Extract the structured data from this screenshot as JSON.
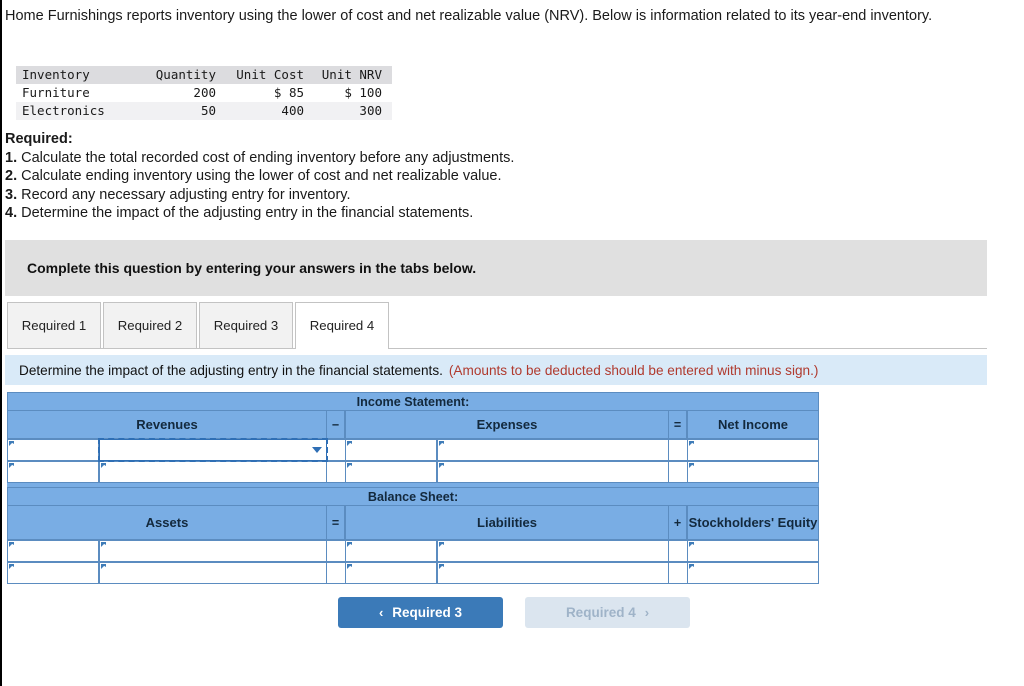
{
  "intro": {
    "text": "Home Furnishings reports inventory using the lower of cost and net realizable value (NRV). Below is information related to its year-end inventory."
  },
  "inventory_table": {
    "columns": [
      "Inventory",
      "Quantity",
      "Unit Cost",
      "Unit NRV"
    ],
    "rows": [
      {
        "inventory": "Furniture",
        "quantity": "200",
        "unit_cost": "$ 85",
        "unit_nrv": "$ 100"
      },
      {
        "inventory": "Electronics",
        "quantity": "50",
        "unit_cost": "400",
        "unit_nrv": "300"
      }
    ]
  },
  "required": {
    "title": "Required:",
    "items": [
      {
        "num": "1.",
        "text": "Calculate the total recorded cost of ending inventory before any adjustments."
      },
      {
        "num": "2.",
        "text": "Calculate ending inventory using the lower of cost and net realizable value."
      },
      {
        "num": "3.",
        "text": "Record any necessary adjusting entry for inventory."
      },
      {
        "num": "4.",
        "text": "Determine the impact of the adjusting entry in the financial statements."
      }
    ]
  },
  "complete_banner": {
    "text": "Complete this question by entering your answers in the tabs below."
  },
  "tabs": [
    {
      "label": "Required 1",
      "active": false
    },
    {
      "label": "Required 2",
      "active": false
    },
    {
      "label": "Required 3",
      "active": false
    },
    {
      "label": "Required 4",
      "active": true
    }
  ],
  "instruction": {
    "text": "Determine the impact of the adjusting entry in the financial statements.",
    "note": "(Amounts to be deducted should be entered with minus sign.)"
  },
  "financials": {
    "income_statement": {
      "title": "Income Statement:",
      "col1": "Revenues",
      "op1": "−",
      "col2": "Expenses",
      "op2": "=",
      "col3": "Net Income",
      "rows": [
        {
          "c1_label": "",
          "c1_value": "",
          "c2_label": "",
          "c2_value": "",
          "c3_value": "",
          "selected": true
        },
        {
          "c1_label": "",
          "c1_value": "",
          "c2_label": "",
          "c2_value": "",
          "c3_value": "",
          "selected": false
        }
      ]
    },
    "balance_sheet": {
      "title": "Balance Sheet:",
      "col1": "Assets",
      "op1": "=",
      "col2": "Liabilities",
      "op2": "+",
      "col3": "Stockholders' Equity",
      "rows": [
        {
          "c1_label": "",
          "c1_value": "",
          "c2_label": "",
          "c2_value": "",
          "c3_value": "",
          "selected": false
        },
        {
          "c1_label": "",
          "c1_value": "",
          "c2_label": "",
          "c2_value": "",
          "c3_value": "",
          "selected": false
        }
      ]
    }
  },
  "nav": {
    "prev_label": "Required 3",
    "prev_chevron": "‹",
    "next_label": "Required 4",
    "next_chevron": "›"
  },
  "colors": {
    "header_blue": "#79ade4",
    "border_blue": "#5b8cc0",
    "button_blue": "#3b7ab8",
    "button_disabled": "#dbe5ef",
    "banner_gray": "#e0e0e0",
    "instruction_blue": "#d9eaf8",
    "note_red": "#b03a2e"
  }
}
